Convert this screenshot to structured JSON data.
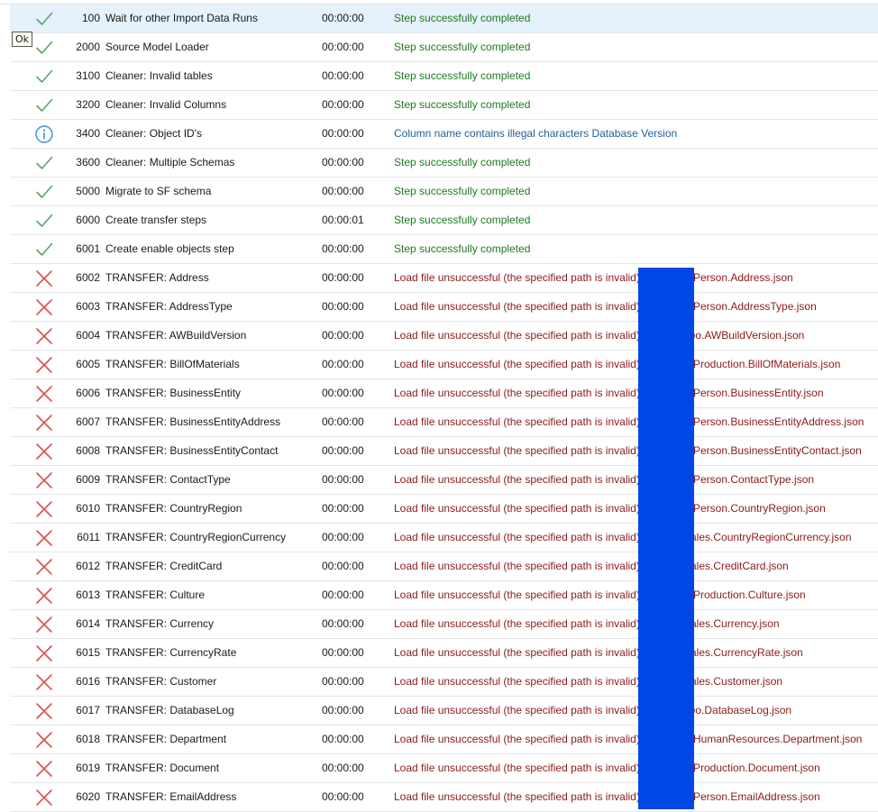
{
  "colors": {
    "success": "#1e7a1e",
    "info": "#1f5f9c",
    "error": "#8b1a1a",
    "check_icon": "#5aa469",
    "cross_icon": "#d9534f",
    "info_icon": "#3a8fd6",
    "redaction": "#0048e6",
    "selected_row": "#e5f1fb"
  },
  "tooltip": {
    "text": "Ok"
  },
  "steps": [
    {
      "status": "success",
      "icon": "check-icon",
      "id": "100",
      "name": "Wait for other Import Data Runs",
      "duration": "00:00:00",
      "message": "Step successfully completed",
      "file": "",
      "selected": true
    },
    {
      "status": "success",
      "icon": "check-icon",
      "id": "2000",
      "name": "Source Model Loader",
      "duration": "00:00:00",
      "message": "Step successfully completed",
      "file": ""
    },
    {
      "status": "success",
      "icon": "check-icon",
      "id": "3100",
      "name": "Cleaner: Invalid tables",
      "duration": "00:00:00",
      "message": "Step successfully completed",
      "file": ""
    },
    {
      "status": "success",
      "icon": "check-icon",
      "id": "3200",
      "name": "Cleaner: Invalid Columns",
      "duration": "00:00:00",
      "message": "Step successfully completed",
      "file": ""
    },
    {
      "status": "info",
      "icon": "info-icon",
      "id": "3400",
      "name": "Cleaner: Object ID's",
      "duration": "00:00:00",
      "message": "Column name contains illegal characters Database Version",
      "file": ""
    },
    {
      "status": "success",
      "icon": "check-icon",
      "id": "3600",
      "name": "Cleaner: Multiple Schemas",
      "duration": "00:00:00",
      "message": "Step successfully completed",
      "file": ""
    },
    {
      "status": "success",
      "icon": "check-icon",
      "id": "5000",
      "name": "Migrate to SF schema",
      "duration": "00:00:00",
      "message": "Step successfully completed",
      "file": ""
    },
    {
      "status": "success",
      "icon": "check-icon",
      "id": "6000",
      "name": "Create transfer steps",
      "duration": "00:00:01",
      "message": "Step successfully completed",
      "file": ""
    },
    {
      "status": "success",
      "icon": "check-icon",
      "id": "6001",
      "name": "Create enable objects step",
      "duration": "00:00:00",
      "message": "Step successfully completed",
      "file": ""
    },
    {
      "status": "error",
      "icon": "cross-icon",
      "id": "6002",
      "name": "TRANSFER: Address",
      "duration": "00:00:00",
      "message": "Load file unsuccessful (the specified path is invalid)",
      "file": "Person.Address.json"
    },
    {
      "status": "error",
      "icon": "cross-icon",
      "id": "6003",
      "name": "TRANSFER: AddressType",
      "duration": "00:00:00",
      "message": "Load file unsuccessful (the specified path is invalid)",
      "file": "Person.AddressType.json"
    },
    {
      "status": "error",
      "icon": "cross-icon",
      "id": "6004",
      "name": "TRANSFER: AWBuildVersion",
      "duration": "00:00:00",
      "message": "Load file unsuccessful (the specified path is invalid)",
      "file": "dbo.AWBuildVersion.json"
    },
    {
      "status": "error",
      "icon": "cross-icon",
      "id": "6005",
      "name": "TRANSFER: BillOfMaterials",
      "duration": "00:00:00",
      "message": "Load file unsuccessful (the specified path is invalid)",
      "file": "Production.BillOfMaterials.json"
    },
    {
      "status": "error",
      "icon": "cross-icon",
      "id": "6006",
      "name": "TRANSFER: BusinessEntity",
      "duration": "00:00:00",
      "message": "Load file unsuccessful (the specified path is invalid)",
      "file": "Person.BusinessEntity.json"
    },
    {
      "status": "error",
      "icon": "cross-icon",
      "id": "6007",
      "name": "TRANSFER: BusinessEntityAddress",
      "duration": "00:00:00",
      "message": "Load file unsuccessful (the specified path is invalid)",
      "file": "Person.BusinessEntityAddress.json"
    },
    {
      "status": "error",
      "icon": "cross-icon",
      "id": "6008",
      "name": "TRANSFER: BusinessEntityContact",
      "duration": "00:00:00",
      "message": "Load file unsuccessful (the specified path is invalid)",
      "file": "Person.BusinessEntityContact.json"
    },
    {
      "status": "error",
      "icon": "cross-icon",
      "id": "6009",
      "name": "TRANSFER: ContactType",
      "duration": "00:00:00",
      "message": "Load file unsuccessful (the specified path is invalid)",
      "file": "Person.ContactType.json"
    },
    {
      "status": "error",
      "icon": "cross-icon",
      "id": "6010",
      "name": "TRANSFER: CountryRegion",
      "duration": "00:00:00",
      "message": "Load file unsuccessful (the specified path is invalid)",
      "file": "Person.CountryRegion.json"
    },
    {
      "status": "error",
      "icon": "cross-icon",
      "id": "6011",
      "name": "TRANSFER: CountryRegionCurrency",
      "duration": "00:00:00",
      "message": "Load file unsuccessful (the specified path is invalid)",
      "file": "Sales.CountryRegionCurrency.json"
    },
    {
      "status": "error",
      "icon": "cross-icon",
      "id": "6012",
      "name": "TRANSFER: CreditCard",
      "duration": "00:00:00",
      "message": "Load file unsuccessful (the specified path is invalid)",
      "file": "Sales.CreditCard.json"
    },
    {
      "status": "error",
      "icon": "cross-icon",
      "id": "6013",
      "name": "TRANSFER: Culture",
      "duration": "00:00:00",
      "message": "Load file unsuccessful (the specified path is invalid)",
      "file": "Production.Culture.json"
    },
    {
      "status": "error",
      "icon": "cross-icon",
      "id": "6014",
      "name": "TRANSFER: Currency",
      "duration": "00:00:00",
      "message": "Load file unsuccessful (the specified path is invalid)",
      "file": "Sales.Currency.json"
    },
    {
      "status": "error",
      "icon": "cross-icon",
      "id": "6015",
      "name": "TRANSFER: CurrencyRate",
      "duration": "00:00:00",
      "message": "Load file unsuccessful (the specified path is invalid)",
      "file": "Sales.CurrencyRate.json"
    },
    {
      "status": "error",
      "icon": "cross-icon",
      "id": "6016",
      "name": "TRANSFER: Customer",
      "duration": "00:00:00",
      "message": "Load file unsuccessful (the specified path is invalid)",
      "file": "Sales.Customer.json"
    },
    {
      "status": "error",
      "icon": "cross-icon",
      "id": "6017",
      "name": "TRANSFER: DatabaseLog",
      "duration": "00:00:00",
      "message": "Load file unsuccessful (the specified path is invalid)",
      "file": "dbo.DatabaseLog.json"
    },
    {
      "status": "error",
      "icon": "cross-icon",
      "id": "6018",
      "name": "TRANSFER: Department",
      "duration": "00:00:00",
      "message": "Load file unsuccessful (the specified path is invalid)",
      "file": "HumanResources.Department.json"
    },
    {
      "status": "error",
      "icon": "cross-icon",
      "id": "6019",
      "name": "TRANSFER: Document",
      "duration": "00:00:00",
      "message": "Load file unsuccessful (the specified path is invalid)",
      "file": "Production.Document.json"
    },
    {
      "status": "error",
      "icon": "cross-icon",
      "id": "6020",
      "name": "TRANSFER: EmailAddress",
      "duration": "00:00:00",
      "message": "Load file unsuccessful (the specified path is invalid)",
      "file": "Person.EmailAddress.json"
    }
  ]
}
